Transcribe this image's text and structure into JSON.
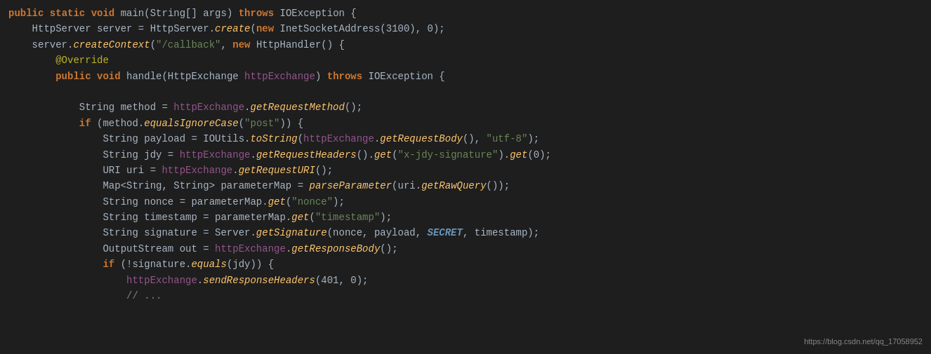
{
  "code": {
    "lines": [
      {
        "id": "line1",
        "indent": 0,
        "tokens": [
          {
            "type": "kw",
            "text": "public"
          },
          {
            "type": "plain",
            "text": " "
          },
          {
            "type": "kw",
            "text": "static"
          },
          {
            "type": "plain",
            "text": " "
          },
          {
            "type": "kw",
            "text": "void"
          },
          {
            "type": "plain",
            "text": " "
          },
          {
            "type": "plain",
            "text": "main"
          },
          {
            "type": "plain",
            "text": "(String[] args) "
          },
          {
            "type": "kw-throws",
            "text": "throws"
          },
          {
            "type": "plain",
            "text": " IOException {"
          }
        ]
      }
    ],
    "watermark": "https://blog.csdn.net/qq_17058952"
  }
}
